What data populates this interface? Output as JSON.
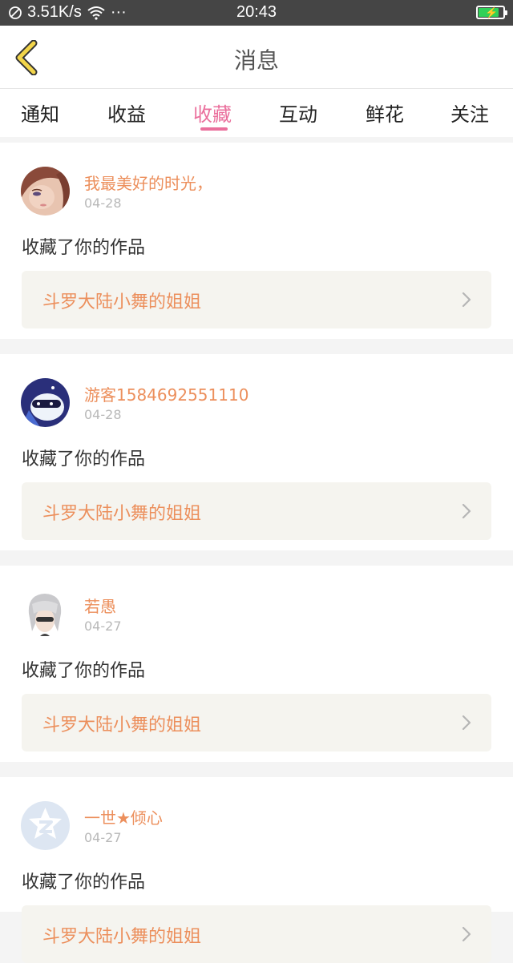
{
  "status_bar": {
    "network_speed": "3.51K/s",
    "dots": "···",
    "time": "20:43",
    "battery_level": 0.85
  },
  "header": {
    "title": "消息"
  },
  "tabs": [
    {
      "label": "通知",
      "active": false
    },
    {
      "label": "收益",
      "active": false
    },
    {
      "label": "收藏",
      "active": true
    },
    {
      "label": "互动",
      "active": false
    },
    {
      "label": "鲜花",
      "active": false
    },
    {
      "label": "关注",
      "active": false
    }
  ],
  "notifications": [
    {
      "user": "我最美好的时光，",
      "date": "04-28",
      "action": "收藏了你的作品",
      "work": "斗罗大陆小舞的姐姐",
      "avatar": "girl-avatar"
    },
    {
      "user": "游客1584692551110",
      "date": "04-28",
      "action": "收藏了你的作品",
      "work": "斗罗大陆小舞的姐姐",
      "avatar": "robot-avatar"
    },
    {
      "user": "若愚",
      "date": "04-27",
      "action": "收藏了你的作品",
      "work": "斗罗大陆小舞的姐姐",
      "avatar": "silver-hair-avatar"
    },
    {
      "user": "一世★倾心",
      "date": "04-27",
      "action": "收藏了你的作品",
      "work": "斗罗大陆小舞的姐姐",
      "avatar": "default-avatar"
    }
  ],
  "colors": {
    "accent": "#ea6f9c",
    "name": "#ec8f5c",
    "back_icon": "#f2d54a"
  }
}
